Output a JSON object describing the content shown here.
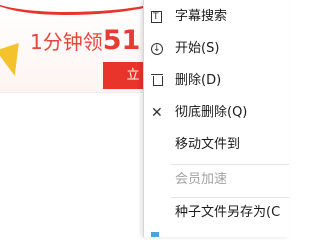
{
  "banner": {
    "promo_prefix": "1分钟领",
    "promo_amount": "51",
    "cta_label": "立"
  },
  "menu": {
    "items": [
      {
        "label": "字幕搜索",
        "icon": "subtitle-t-icon",
        "enabled": true
      },
      {
        "label": "开始(S)",
        "icon": "download-circle-icon",
        "enabled": true
      },
      {
        "label": "删除(D)",
        "icon": "trash-icon",
        "enabled": true
      },
      {
        "label": "彻底删除(Q)",
        "icon": "close-x-icon",
        "enabled": true
      },
      {
        "label": "移动文件到",
        "icon": "",
        "enabled": true
      },
      {
        "label": "会员加速",
        "icon": "",
        "enabled": false
      },
      {
        "label": "种子文件另存为(C",
        "icon": "",
        "enabled": true
      }
    ]
  },
  "colors": {
    "accent": "#e8342b",
    "disabled_text": "#a2a2a2",
    "menu_text": "#1b1b1b"
  }
}
